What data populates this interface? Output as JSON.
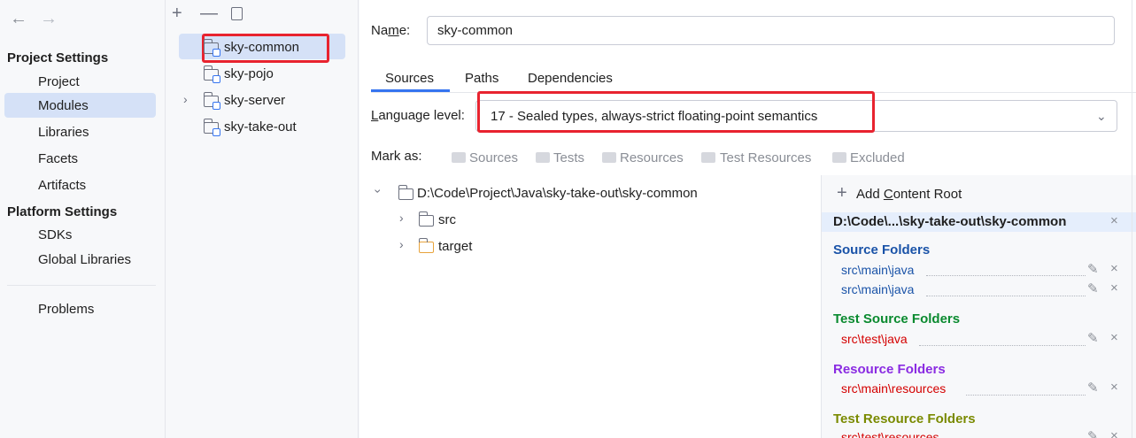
{
  "nav": {
    "back_icon": "arrow-left-icon",
    "forward_icon": "arrow-right-icon",
    "project_settings": "Project Settings",
    "project_items": [
      "Project",
      "Modules",
      "Libraries",
      "Facets",
      "Artifacts"
    ],
    "platform_settings": "Platform Settings",
    "platform_items": [
      "SDKs",
      "Global Libraries"
    ],
    "problems": "Problems",
    "selected": "Modules"
  },
  "modules": {
    "toolbar": {
      "add": "+",
      "remove": "—",
      "copy": "copy-icon"
    },
    "items": [
      "sky-common",
      "sky-pojo",
      "sky-server",
      "sky-take-out"
    ],
    "selected": "sky-common"
  },
  "main": {
    "name_label_pre": "Na",
    "name_label_ul": "m",
    "name_label_post": "e:",
    "name_value": "sky-common",
    "tabs": [
      "Sources",
      "Paths",
      "Dependencies"
    ],
    "active_tab": "Sources",
    "lang_label_pre": "L",
    "lang_label_post": "anguage level:",
    "lang_value": "17 - Sealed types, always-strict floating-point semantics",
    "mark_as": "Mark as:",
    "mark_options": [
      "Sources",
      "Tests",
      "Resources",
      "Test Resources",
      "Excluded"
    ],
    "tree": {
      "root": "D:\\Code\\Project\\Java\\sky-take-out\\sky-common",
      "children": [
        "src",
        "target"
      ]
    },
    "content_roots": {
      "add_pre": "Add ",
      "add_ul": "C",
      "add_post": "ontent Root",
      "root_path": "D:\\Code\\...\\sky-take-out\\sky-common",
      "source_folders_title": "Source Folders",
      "source_folders": [
        "src\\main\\java",
        "src\\main\\java"
      ],
      "test_source_title": "Test Source Folders",
      "test_source_folders": [
        "src\\test\\java"
      ],
      "resource_title": "Resource Folders",
      "resource_folders": [
        "src\\main\\resources"
      ],
      "test_resource_title": "Test Resource Folders",
      "test_resource_folders": [
        "src\\test\\resources"
      ]
    }
  },
  "colors": {
    "accent": "#3574f0",
    "selection": "#d5e1f7",
    "highlight_box": "#e8232f",
    "source": "#1a53a8",
    "test_source": "#0a8a2f",
    "test_path": "#d40000",
    "resource": "#8a2be2",
    "test_resource": "#7a8a00"
  }
}
